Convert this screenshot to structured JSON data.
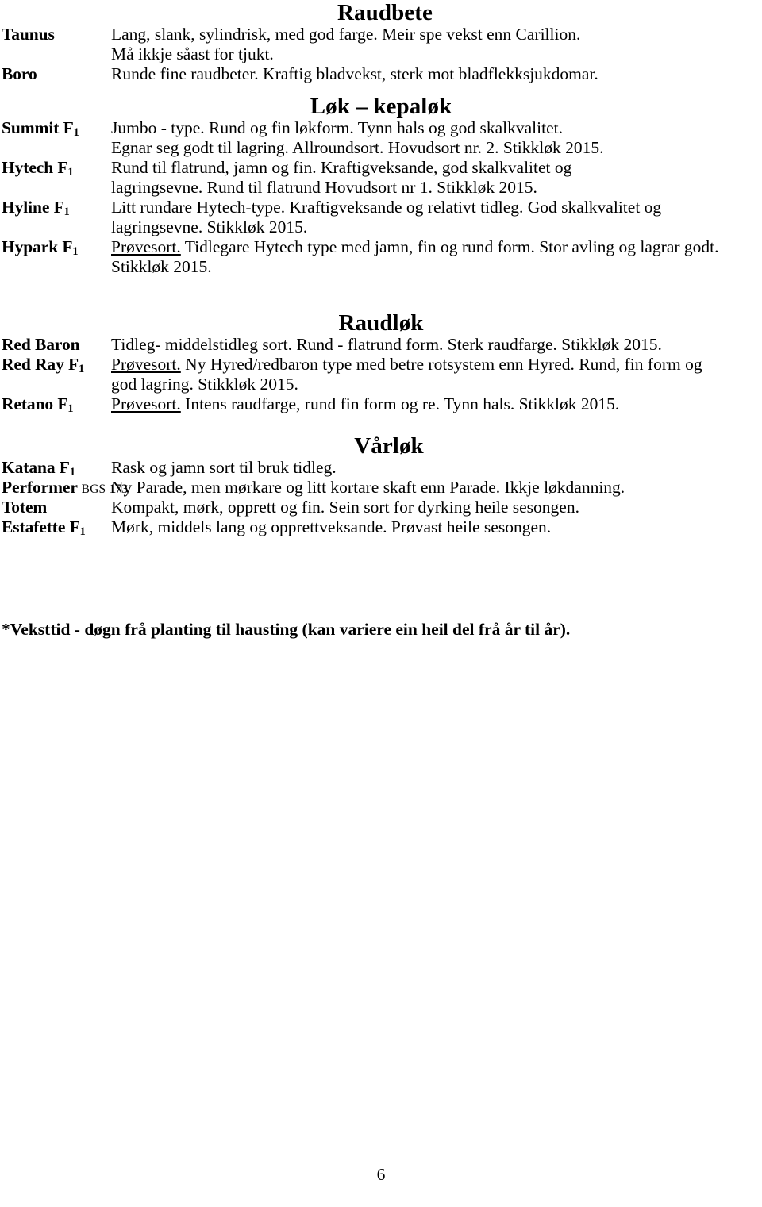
{
  "document": {
    "page_number": "6",
    "footnote": "*Veksttid - døgn frå planting til hausting (kan variere ein heil del frå år til år)."
  },
  "sections": [
    {
      "heading": "Raudbete",
      "varieties": [
        {
          "name": "Taunus",
          "suffix": "",
          "code": "",
          "lines": [
            "Lang, slank, sylindrisk, med god farge. Meir spe vekst enn Carillion.",
            "Må ikkje såast for tjukt."
          ]
        },
        {
          "name": "Boro",
          "suffix": "",
          "code": "",
          "lines": [
            "Runde fine raudbeter. Kraftig bladvekst, sterk mot bladflekksjukdomar."
          ]
        }
      ]
    },
    {
      "heading": "Løk – kepaløk",
      "varieties": [
        {
          "name": "Summit",
          "suffix": "F",
          "sub": "1",
          "code": "",
          "lines": [
            "Jumbo - type. Rund og fin løkform. Tynn hals og god skalkvalitet.",
            "Egnar seg godt til lagring. Allroundsort. Hovudsort nr. 2. Stikkløk 2015."
          ]
        },
        {
          "name": "Hytech",
          "suffix": "F",
          "sub": "1",
          "code": "",
          "lines": [
            "Rund til flatrund, jamn og fin. Kraftigveksande, god skalkvalitet og",
            "lagringsevne. Rund til flatrund Hovudsort nr 1. Stikkløk 2015."
          ]
        },
        {
          "name": "Hyline",
          "suffix": "F",
          "sub": "1",
          "code": "",
          "lines": [
            "Litt rundare Hytech-type. Kraftigveksande og relativt tidleg. God skalkvalitet og",
            "lagringsevne. Stikkløk 2015."
          ]
        },
        {
          "name": "Hypark",
          "suffix": "F",
          "sub": "1",
          "code": "",
          "prefix_underlined": "Prøvesort.",
          "lines": [
            " Tidlegare Hytech type med jamn, fin og rund form. Stor avling og lagrar godt.",
            "Stikkløk 2015."
          ],
          "last_line_full_width": true
        }
      ]
    },
    {
      "heading": "Raudløk",
      "varieties": [
        {
          "name": "Red Baron",
          "suffix": "",
          "code": "",
          "lines": [
            "Tidleg- middelstidleg sort. Rund - flatrund form. Sterk raudfarge. Stikkløk 2015."
          ]
        },
        {
          "name": "Red Ray",
          "suffix": "F",
          "sub": "1",
          "code": "",
          "prefix_underlined": "Prøvesort.",
          "lines": [
            "  Ny Hyred/redbaron type med betre rotsystem enn Hyred. Rund, fin form og",
            "god lagring. Stikkløk 2015."
          ]
        },
        {
          "name": "Retano",
          "suffix": "F",
          "sub": "1",
          "code": "",
          "prefix_underlined": "Prøvesort.",
          "lines": [
            " Intens raudfarge, rund fin form og re. Tynn hals.  Stikkløk 2015."
          ]
        }
      ]
    },
    {
      "heading": "Vårløk",
      "varieties": [
        {
          "name": "Katana",
          "suffix": "F",
          "sub": "1",
          "code": "",
          "lines": [
            "Rask og jamn sort til bruk tidleg."
          ]
        },
        {
          "name": "Performer",
          "suffix": "",
          "code": "BGS 173",
          "lines": [
            "Ny Parade, men mørkare og litt kortare skaft enn Parade. Ikkje løkdanning."
          ]
        },
        {
          "name": "Totem",
          "suffix": "",
          "code": "",
          "lines": [
            "Kompakt, mørk, opprett og fin. Sein sort for dyrking heile sesongen."
          ]
        },
        {
          "name": "Estafette",
          "suffix": "F",
          "sub": "1",
          "code": "",
          "lines": [
            "Mørk, middels lang og opprettveksande. Prøvast heile sesongen."
          ]
        }
      ]
    }
  ]
}
